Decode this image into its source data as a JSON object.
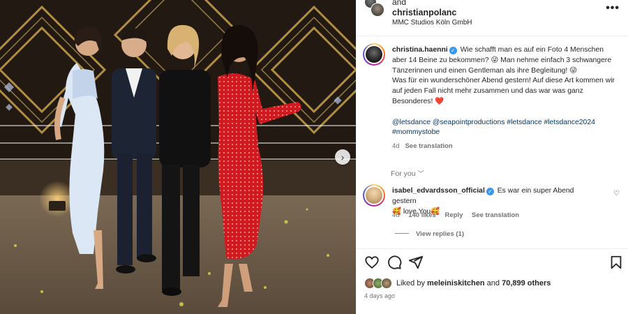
{
  "header": {
    "and_text": "and",
    "username": "christianpolanc",
    "location": "MMC Studios Köln GmbH",
    "more_glyph": "•••"
  },
  "caption": {
    "username": "christina.haenni",
    "line_1": "Wie schafft man es auf ein Foto 4 Menschen aber 14 Beine zu bekommen?",
    "emoji_1": "😜",
    "line_2": "Man nehme einfach 3 schwangere Tänzerinnen und einen Gentleman als ihre Begleitung!",
    "emoji_2": "😜",
    "line_3": "Was für ein wunderschöner Abend gestern! Auf diese Art kommen wir auf jeden Fall nicht mehr zusammen und das war was ganz Besonderes!",
    "emoji_3": "❤️",
    "tags": "@letsdance @seapointproductions #letsdance #letsdance2024 #mommystobe",
    "age": "4d",
    "see_translation": "See translation"
  },
  "for_you": "For you",
  "comment": {
    "username": "isabel_edvardsson_official",
    "text": "Es war ein super Abend gestern",
    "emoji_a": "🥰",
    "text_2": "love You",
    "emoji_b": "🥰",
    "age": "4d",
    "likes": "140 likes",
    "reply": "Reply",
    "see_translation": "See translation",
    "view_replies": "View replies (1)"
  },
  "likes": {
    "prefix": "Liked by",
    "user": "meleiniskitchen",
    "middle": "and",
    "count": "70,899 others"
  },
  "posted": "4 days ago",
  "icons": {
    "more": "more-icon",
    "heart": "heart-icon",
    "comment": "comment-icon",
    "share": "share-icon",
    "save": "bookmark-icon",
    "next": "chevron-right-icon",
    "verified": "verified-badge-icon"
  },
  "colors": {
    "link": "#00376b",
    "verified": "#3897f0",
    "muted": "#737373",
    "heart_red": "#ed4956"
  }
}
